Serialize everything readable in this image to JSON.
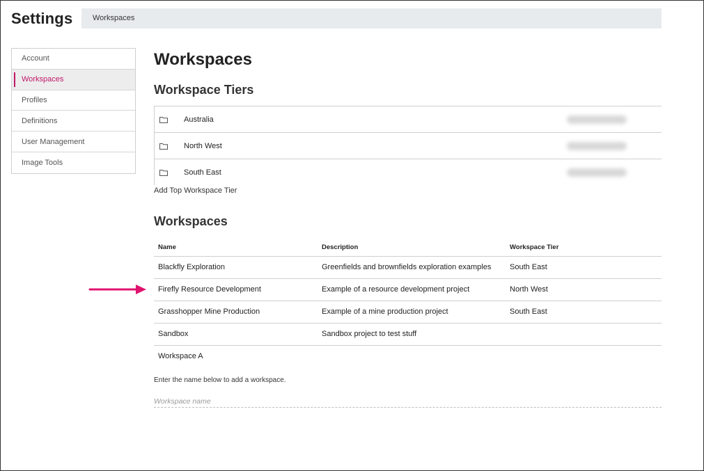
{
  "header": {
    "app_title": "Settings",
    "breadcrumb": "Workspaces"
  },
  "sidebar": {
    "items": [
      {
        "label": "Account",
        "active": false
      },
      {
        "label": "Workspaces",
        "active": true
      },
      {
        "label": "Profiles",
        "active": false
      },
      {
        "label": "Definitions",
        "active": false
      },
      {
        "label": "User Management",
        "active": false
      },
      {
        "label": "Image Tools",
        "active": false
      }
    ]
  },
  "main": {
    "page_title": "Workspaces",
    "tiers_section": {
      "title": "Workspace Tiers",
      "tiers": [
        {
          "name": "Australia",
          "icon": "folder-icon"
        },
        {
          "name": "North West",
          "icon": "folder-icon"
        },
        {
          "name": "South East",
          "icon": "folder-icon"
        }
      ],
      "add_link": "Add Top Workspace Tier"
    },
    "workspaces_section": {
      "title": "Workspaces",
      "columns": [
        "Name",
        "Description",
        "Workspace Tier"
      ],
      "rows": [
        {
          "name": "Blackfly Exploration",
          "description": "Greenfields and brownfields exploration examples",
          "tier": "South East"
        },
        {
          "name": "Firefly Resource Development",
          "description": "Example of a resource development project",
          "tier": "North West"
        },
        {
          "name": "Grasshopper Mine Production",
          "description": "Example of a mine production project",
          "tier": "South East"
        },
        {
          "name": "Sandbox",
          "description": "Sandbox project to test stuff",
          "tier": ""
        },
        {
          "name": "Workspace A",
          "description": "",
          "tier": ""
        }
      ],
      "hint": "Enter the name below to add a workspace.",
      "input_placeholder": "Workspace name",
      "input_value": ""
    }
  },
  "colors": {
    "accent": "#c0186a",
    "breadcrumb_bg": "#e8ebee",
    "active_item_bg": "#ededed",
    "arrow": "#e0136f"
  }
}
